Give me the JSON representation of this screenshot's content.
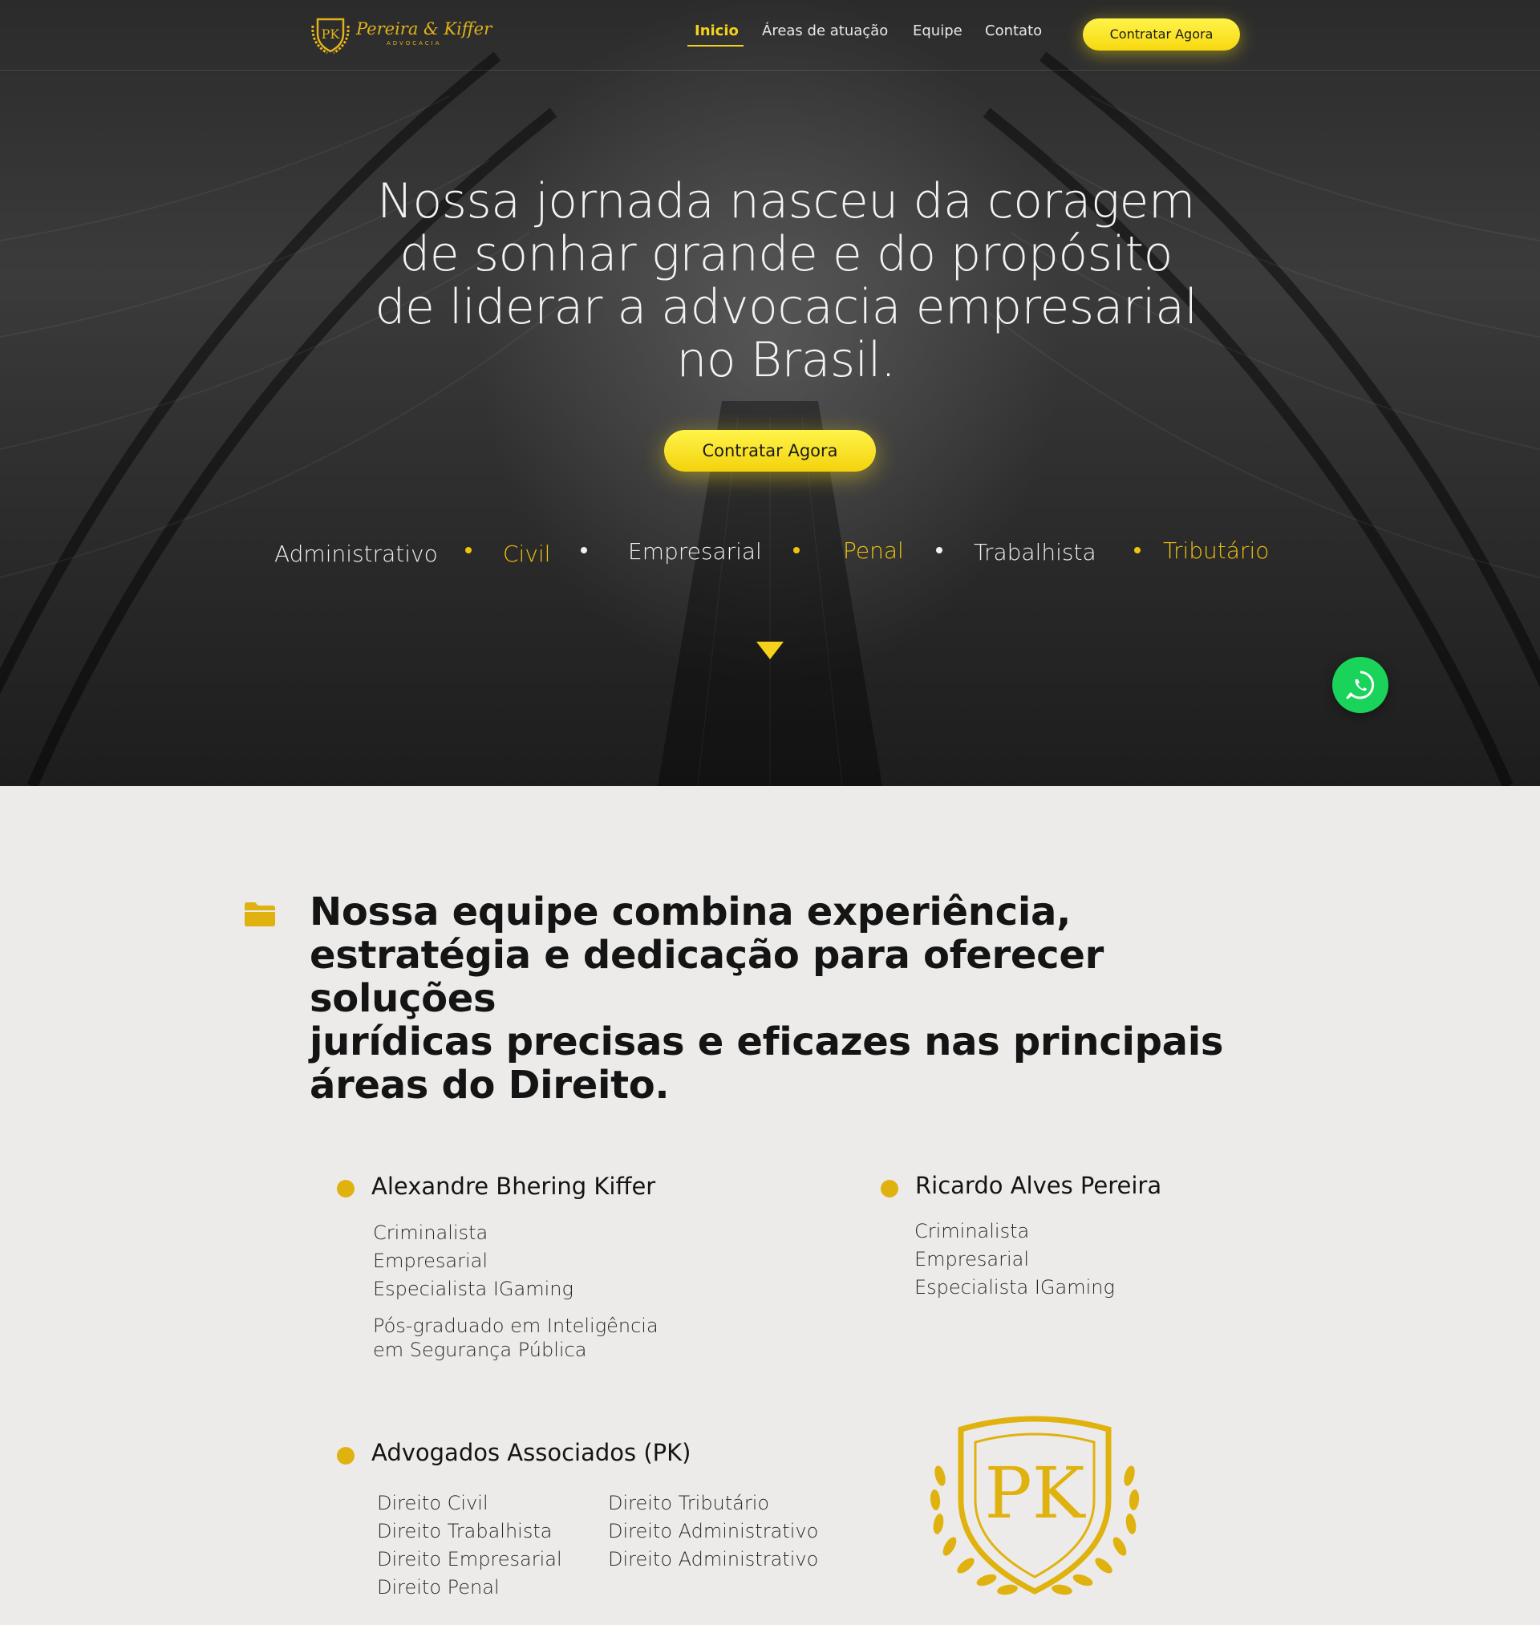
{
  "nav": {
    "logo_text": "Pereira & Kiffer",
    "logo_sub": "ADVOCACIA",
    "logo_mark": "PK",
    "links": [
      "Inicio",
      "Áreas de atuação",
      "Equipe",
      "Contato"
    ],
    "cta": "Contratar Agora"
  },
  "hero": {
    "title_lines": [
      "Nossa jornada nasceu da coragem",
      "de sonhar grande e do propósito",
      "de liderar a advocacia empresarial",
      "no Brasil."
    ],
    "cta": "Contratar Agora",
    "areas": [
      "Administrativo",
      "Civil",
      "Empresarial",
      "Penal",
      "Trabalhista",
      "Tributário"
    ]
  },
  "colors": {
    "accent": "#f6d21a",
    "gold": "#e0b20f",
    "whatsapp": "#1ad35a"
  },
  "team": {
    "heading_lines": [
      "Nossa equipe combina experiência,",
      "estratégia e dedicação para oferecer soluções",
      "jurídicas precisas e eficazes nas principais",
      "áreas do Direito."
    ],
    "people": [
      {
        "name": "Alexandre Bhering Kiffer",
        "specialties": [
          "Criminalista",
          "Empresarial",
          "Especialista IGaming"
        ],
        "note_lines": [
          "Pós-graduado em Inteligência",
          "em Segurança Pública"
        ]
      },
      {
        "name": "Ricardo Alves Pereira",
        "specialties": [
          "Criminalista",
          "Empresarial",
          "Especialista IGaming"
        ]
      }
    ],
    "associates": {
      "name": "Advogados Associados (PK)",
      "col1": [
        "Direito Civil",
        "Direito Trabalhista",
        "Direito Empresarial",
        "Direito Penal"
      ],
      "col2": [
        "Direito Tributário",
        "Direito Administrativo",
        "Direito Administrativo"
      ]
    },
    "crest_mark": "PK"
  },
  "icons": [
    "folder-icon",
    "whatsapp-icon",
    "chevron-down-icon",
    "crest-logo"
  ]
}
